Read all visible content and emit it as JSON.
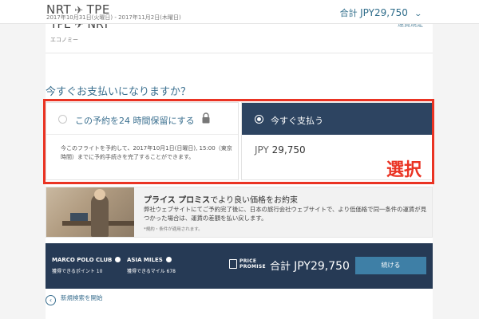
{
  "header": {
    "origin": "NRT",
    "destination": "TPE",
    "dates": "2017年10月31日(火曜日) - 2017年11月2日(木曜日)",
    "total_label": "合計",
    "total_amount": "JPY29,750",
    "icons": [
      "plane-icon",
      "chevron-down-icon"
    ]
  },
  "flight": {
    "route_title": "TPE ✈ NRT",
    "cabin": "エコノミー",
    "link": "運賃規定"
  },
  "payment": {
    "question": "今すぐお支払いになりますか？",
    "hold_option": {
      "label": "この予約を24 時間保留にする",
      "description": "今このフライトを予約して、2017年10月1日(日曜日), 15:00（東京時間）までに予約手続きを完了することができます。"
    },
    "pay_now_option": {
      "label": "今すぐ支払う",
      "currency": "JPY",
      "amount": "29,750"
    },
    "annotation": "選択",
    "selected": "pay_now",
    "accent_color": "#ea3323"
  },
  "price_promise": {
    "title_bold": "プライス プロミス",
    "title_rest": "でより良い価格をお約束",
    "body": "弊社ウェブサイトにてご予約完了後に、日本の旅行会社ウェブサイトで、より低価格で同一条件の運賃が見つかった場合は、運賃の差額を払い戻します。",
    "note": "*規約・条件が適用されます。"
  },
  "summary": {
    "marco_polo_label": "MARCO POLO CLUB",
    "marco_polo_points": "獲得できるポイント 10",
    "asia_miles_label": "ASIA MILES",
    "asia_miles_value": "獲得できるマイル 678",
    "price_promise_line1": "PRICE",
    "price_promise_line2": "PROMISE",
    "total_label": "合計",
    "total_amount": "JPY29,750",
    "continue_label": "続ける",
    "bar_color": "#263a55"
  },
  "footer": {
    "new_search": "新規検索を開始"
  }
}
